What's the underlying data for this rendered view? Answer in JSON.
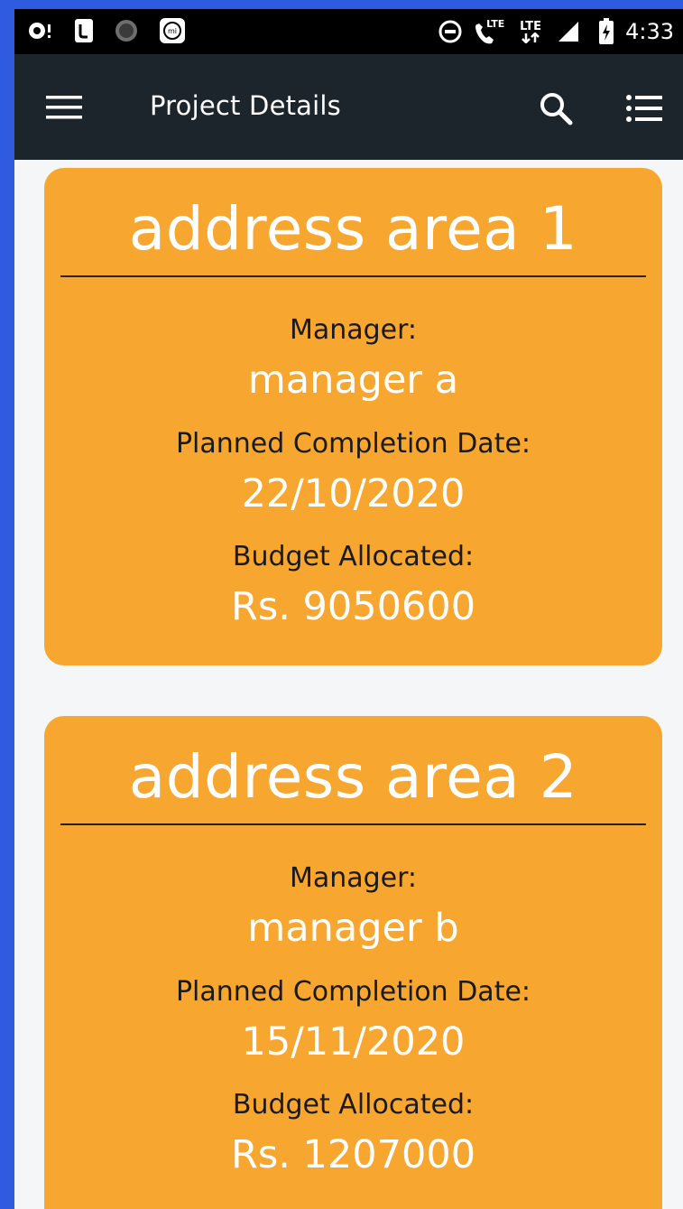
{
  "status_bar": {
    "time": "4:33",
    "lte_1": "LTE",
    "lte_2": "LTE",
    "icons": [
      "notification-dot-icon",
      "phone-icon",
      "circle-dot-icon",
      "mi-icon",
      "dnd-icon",
      "volte-call-icon",
      "lte-signal-icon",
      "signal-icon",
      "battery-charging-icon"
    ]
  },
  "app_bar": {
    "title": "Project Details",
    "icons": [
      "menu-icon",
      "search-icon",
      "list-icon"
    ]
  },
  "projects": [
    {
      "title": "address area 1",
      "manager_label": "Manager:",
      "manager": "manager a",
      "date_label": "Planned Completion Date:",
      "date": "22/10/2020",
      "budget_label": "Budget Allocated:",
      "budget": "Rs. 9050600"
    },
    {
      "title": "address area 2",
      "manager_label": "Manager:",
      "manager": "manager b",
      "date_label": "Planned Completion Date:",
      "date": "15/11/2020",
      "budget_label": "Budget Allocated:",
      "budget": "Rs. 1207000"
    }
  ],
  "colors": {
    "card": "#f7a630",
    "app_bar": "#1d252c",
    "frame": "#2f5be0",
    "background": "#f5f6f8"
  }
}
